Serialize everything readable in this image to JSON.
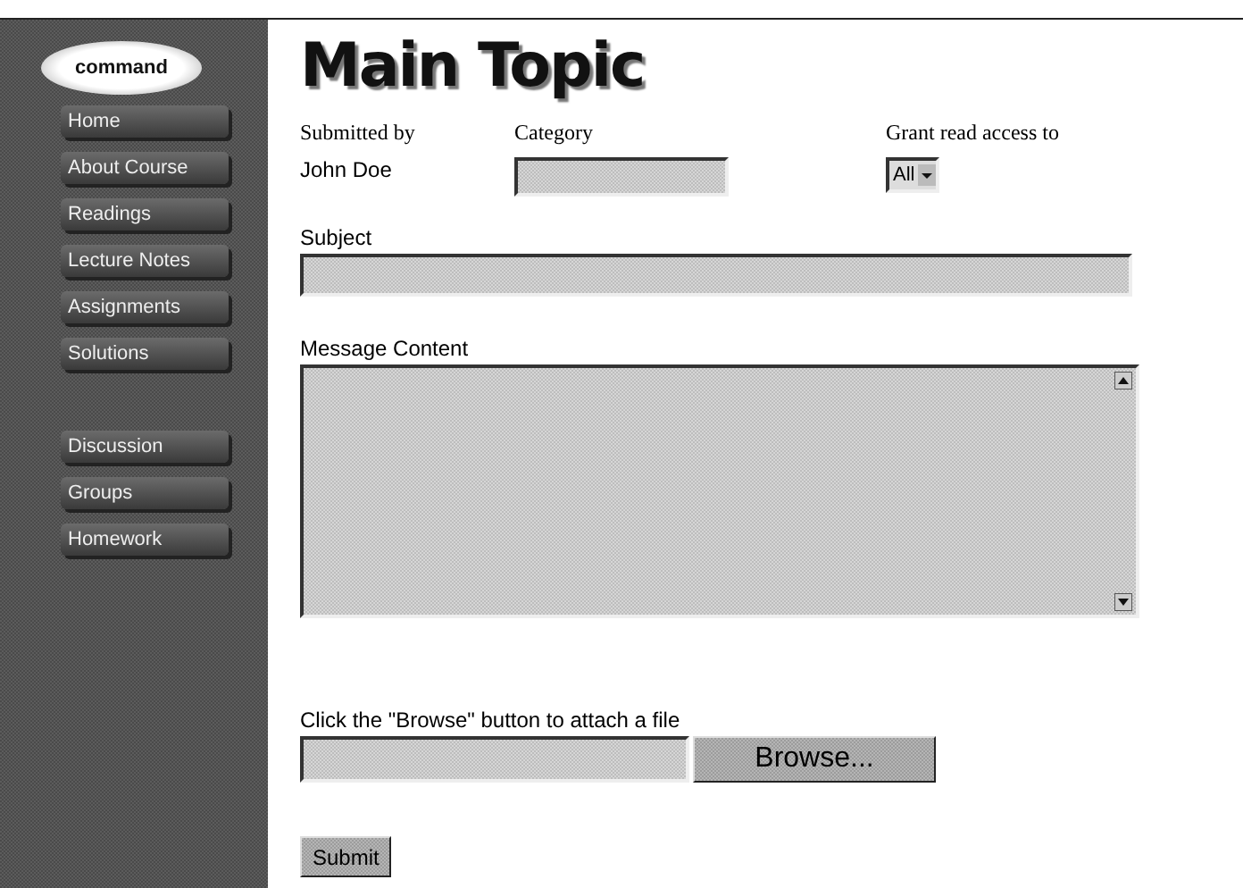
{
  "sidebar": {
    "logo": "command",
    "nav_groups": [
      [
        "Home",
        "About Course",
        "Readings",
        "Lecture Notes",
        "Assignments",
        "Solutions"
      ],
      [
        "Discussion",
        "Groups",
        "Homework"
      ]
    ]
  },
  "title": "Main Topic",
  "submitted_by": {
    "label": "Submitted by",
    "value": "John Doe"
  },
  "category": {
    "label": "Category"
  },
  "read_access": {
    "label": "Grant read access to",
    "value": "All"
  },
  "subject": {
    "label": "Subject"
  },
  "message": {
    "label": "Message Content"
  },
  "attach": {
    "label": "Click the \"Browse\" button to attach a file",
    "button": "Browse..."
  },
  "submit": "Submit"
}
